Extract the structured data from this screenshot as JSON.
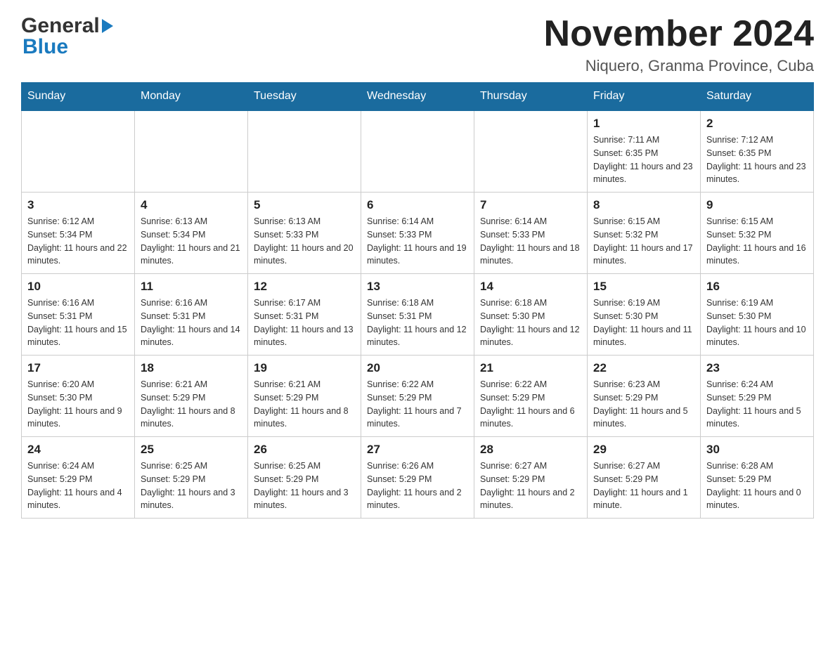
{
  "header": {
    "logo_general": "General",
    "logo_blue": "Blue",
    "month_title": "November 2024",
    "location": "Niquero, Granma Province, Cuba"
  },
  "days_of_week": [
    "Sunday",
    "Monday",
    "Tuesday",
    "Wednesday",
    "Thursday",
    "Friday",
    "Saturday"
  ],
  "weeks": [
    {
      "days": [
        {
          "num": "",
          "sunrise": "",
          "sunset": "",
          "daylight": ""
        },
        {
          "num": "",
          "sunrise": "",
          "sunset": "",
          "daylight": ""
        },
        {
          "num": "",
          "sunrise": "",
          "sunset": "",
          "daylight": ""
        },
        {
          "num": "",
          "sunrise": "",
          "sunset": "",
          "daylight": ""
        },
        {
          "num": "",
          "sunrise": "",
          "sunset": "",
          "daylight": ""
        },
        {
          "num": "1",
          "sunrise": "Sunrise: 7:11 AM",
          "sunset": "Sunset: 6:35 PM",
          "daylight": "Daylight: 11 hours and 23 minutes."
        },
        {
          "num": "2",
          "sunrise": "Sunrise: 7:12 AM",
          "sunset": "Sunset: 6:35 PM",
          "daylight": "Daylight: 11 hours and 23 minutes."
        }
      ]
    },
    {
      "days": [
        {
          "num": "3",
          "sunrise": "Sunrise: 6:12 AM",
          "sunset": "Sunset: 5:34 PM",
          "daylight": "Daylight: 11 hours and 22 minutes."
        },
        {
          "num": "4",
          "sunrise": "Sunrise: 6:13 AM",
          "sunset": "Sunset: 5:34 PM",
          "daylight": "Daylight: 11 hours and 21 minutes."
        },
        {
          "num": "5",
          "sunrise": "Sunrise: 6:13 AM",
          "sunset": "Sunset: 5:33 PM",
          "daylight": "Daylight: 11 hours and 20 minutes."
        },
        {
          "num": "6",
          "sunrise": "Sunrise: 6:14 AM",
          "sunset": "Sunset: 5:33 PM",
          "daylight": "Daylight: 11 hours and 19 minutes."
        },
        {
          "num": "7",
          "sunrise": "Sunrise: 6:14 AM",
          "sunset": "Sunset: 5:33 PM",
          "daylight": "Daylight: 11 hours and 18 minutes."
        },
        {
          "num": "8",
          "sunrise": "Sunrise: 6:15 AM",
          "sunset": "Sunset: 5:32 PM",
          "daylight": "Daylight: 11 hours and 17 minutes."
        },
        {
          "num": "9",
          "sunrise": "Sunrise: 6:15 AM",
          "sunset": "Sunset: 5:32 PM",
          "daylight": "Daylight: 11 hours and 16 minutes."
        }
      ]
    },
    {
      "days": [
        {
          "num": "10",
          "sunrise": "Sunrise: 6:16 AM",
          "sunset": "Sunset: 5:31 PM",
          "daylight": "Daylight: 11 hours and 15 minutes."
        },
        {
          "num": "11",
          "sunrise": "Sunrise: 6:16 AM",
          "sunset": "Sunset: 5:31 PM",
          "daylight": "Daylight: 11 hours and 14 minutes."
        },
        {
          "num": "12",
          "sunrise": "Sunrise: 6:17 AM",
          "sunset": "Sunset: 5:31 PM",
          "daylight": "Daylight: 11 hours and 13 minutes."
        },
        {
          "num": "13",
          "sunrise": "Sunrise: 6:18 AM",
          "sunset": "Sunset: 5:31 PM",
          "daylight": "Daylight: 11 hours and 12 minutes."
        },
        {
          "num": "14",
          "sunrise": "Sunrise: 6:18 AM",
          "sunset": "Sunset: 5:30 PM",
          "daylight": "Daylight: 11 hours and 12 minutes."
        },
        {
          "num": "15",
          "sunrise": "Sunrise: 6:19 AM",
          "sunset": "Sunset: 5:30 PM",
          "daylight": "Daylight: 11 hours and 11 minutes."
        },
        {
          "num": "16",
          "sunrise": "Sunrise: 6:19 AM",
          "sunset": "Sunset: 5:30 PM",
          "daylight": "Daylight: 11 hours and 10 minutes."
        }
      ]
    },
    {
      "days": [
        {
          "num": "17",
          "sunrise": "Sunrise: 6:20 AM",
          "sunset": "Sunset: 5:30 PM",
          "daylight": "Daylight: 11 hours and 9 minutes."
        },
        {
          "num": "18",
          "sunrise": "Sunrise: 6:21 AM",
          "sunset": "Sunset: 5:29 PM",
          "daylight": "Daylight: 11 hours and 8 minutes."
        },
        {
          "num": "19",
          "sunrise": "Sunrise: 6:21 AM",
          "sunset": "Sunset: 5:29 PM",
          "daylight": "Daylight: 11 hours and 8 minutes."
        },
        {
          "num": "20",
          "sunrise": "Sunrise: 6:22 AM",
          "sunset": "Sunset: 5:29 PM",
          "daylight": "Daylight: 11 hours and 7 minutes."
        },
        {
          "num": "21",
          "sunrise": "Sunrise: 6:22 AM",
          "sunset": "Sunset: 5:29 PM",
          "daylight": "Daylight: 11 hours and 6 minutes."
        },
        {
          "num": "22",
          "sunrise": "Sunrise: 6:23 AM",
          "sunset": "Sunset: 5:29 PM",
          "daylight": "Daylight: 11 hours and 5 minutes."
        },
        {
          "num": "23",
          "sunrise": "Sunrise: 6:24 AM",
          "sunset": "Sunset: 5:29 PM",
          "daylight": "Daylight: 11 hours and 5 minutes."
        }
      ]
    },
    {
      "days": [
        {
          "num": "24",
          "sunrise": "Sunrise: 6:24 AM",
          "sunset": "Sunset: 5:29 PM",
          "daylight": "Daylight: 11 hours and 4 minutes."
        },
        {
          "num": "25",
          "sunrise": "Sunrise: 6:25 AM",
          "sunset": "Sunset: 5:29 PM",
          "daylight": "Daylight: 11 hours and 3 minutes."
        },
        {
          "num": "26",
          "sunrise": "Sunrise: 6:25 AM",
          "sunset": "Sunset: 5:29 PM",
          "daylight": "Daylight: 11 hours and 3 minutes."
        },
        {
          "num": "27",
          "sunrise": "Sunrise: 6:26 AM",
          "sunset": "Sunset: 5:29 PM",
          "daylight": "Daylight: 11 hours and 2 minutes."
        },
        {
          "num": "28",
          "sunrise": "Sunrise: 6:27 AM",
          "sunset": "Sunset: 5:29 PM",
          "daylight": "Daylight: 11 hours and 2 minutes."
        },
        {
          "num": "29",
          "sunrise": "Sunrise: 6:27 AM",
          "sunset": "Sunset: 5:29 PM",
          "daylight": "Daylight: 11 hours and 1 minute."
        },
        {
          "num": "30",
          "sunrise": "Sunrise: 6:28 AM",
          "sunset": "Sunset: 5:29 PM",
          "daylight": "Daylight: 11 hours and 0 minutes."
        }
      ]
    }
  ]
}
